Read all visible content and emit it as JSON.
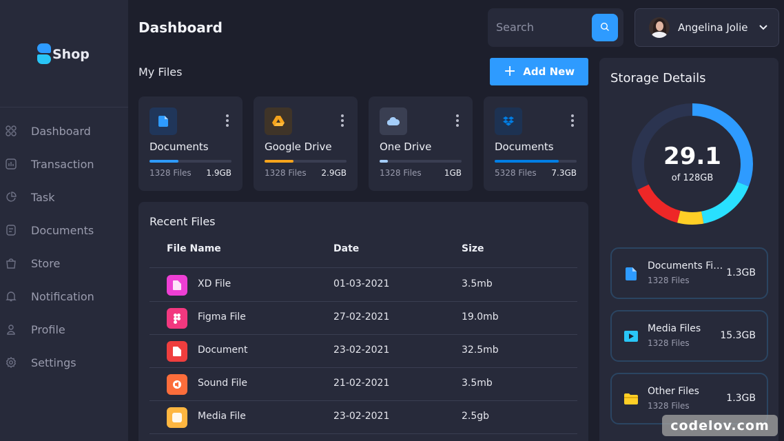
{
  "brand": {
    "name": "Shop",
    "colors": {
      "accent": "#2e9bff",
      "cyan": "#29c5f6"
    }
  },
  "sidebar": {
    "items": [
      {
        "label": "Dashboard",
        "icon": "grid-icon"
      },
      {
        "label": "Transaction",
        "icon": "chart-icon"
      },
      {
        "label": "Task",
        "icon": "pie-icon"
      },
      {
        "label": "Documents",
        "icon": "document-icon"
      },
      {
        "label": "Store",
        "icon": "bag-icon"
      },
      {
        "label": "Notification",
        "icon": "bell-icon"
      },
      {
        "label": "Profile",
        "icon": "user-icon"
      },
      {
        "label": "Settings",
        "icon": "gear-icon"
      }
    ]
  },
  "header": {
    "title": "Dashboard",
    "search_placeholder": "Search",
    "user_name": "Angelina Jolie"
  },
  "my_files": {
    "title": "My Files",
    "add_label": "Add New",
    "cards": [
      {
        "name": "Documents",
        "count": "1328 Files",
        "size": "1.9GB",
        "progress": 0.35,
        "color": "#2e9bff",
        "icon": "document-icon"
      },
      {
        "name": "Google Drive",
        "count": "1328 Files",
        "size": "2.9GB",
        "progress": 0.35,
        "color": "#f6a41c",
        "icon": "google-drive-icon"
      },
      {
        "name": "One Drive",
        "count": "1328 Files",
        "size": "1GB",
        "progress": 0.1,
        "color": "#a4cdf9",
        "icon": "cloud-icon"
      },
      {
        "name": "Documents",
        "count": "5328 Files",
        "size": "7.3GB",
        "progress": 0.78,
        "color": "#007ee5",
        "icon": "dropbox-icon"
      }
    ]
  },
  "recent": {
    "title": "Recent Files",
    "columns": [
      "File Name",
      "Date",
      "Size"
    ],
    "rows": [
      {
        "name": "XD File",
        "date": "01-03-2021",
        "size": "3.5mb",
        "color": "#ee3fd4",
        "icon": "xd-file-icon"
      },
      {
        "name": "Figma File",
        "date": "27-02-2021",
        "size": "19.0mb",
        "color": "#f2387f",
        "icon": "figma-icon"
      },
      {
        "name": "Document",
        "date": "23-02-2021",
        "size": "32.5mb",
        "color": "#ef3e3e",
        "icon": "document-icon"
      },
      {
        "name": "Sound File",
        "date": "21-02-2021",
        "size": "3.5mb",
        "color": "#fc6d3b",
        "icon": "sound-icon"
      },
      {
        "name": "Media File",
        "date": "23-02-2021",
        "size": "2.5gb",
        "color": "#feb640",
        "icon": "media-icon"
      }
    ]
  },
  "storage": {
    "title": "Storage Details",
    "used": "29.1",
    "total_label": "of 128GB",
    "segments": [
      {
        "color": "#2e9bff",
        "fraction": 0.31
      },
      {
        "color": "#29e0ff",
        "fraction": 0.16
      },
      {
        "color": "#ffcf26",
        "fraction": 0.07
      },
      {
        "color": "#ee2727",
        "fraction": 0.14
      },
      {
        "color": "#2b3450",
        "fraction": 0.32
      }
    ],
    "items": [
      {
        "name": "Documents Files",
        "count": "1328 Files",
        "size": "1.3GB",
        "color": "#2e9bff",
        "icon": "document-icon"
      },
      {
        "name": "Media Files",
        "count": "1328 Files",
        "size": "15.3GB",
        "color": "#29c5f6",
        "icon": "media-icon"
      },
      {
        "name": "Other Files",
        "count": "1328 Files",
        "size": "1.3GB",
        "color": "#ffcf26",
        "icon": "folder-icon"
      }
    ]
  },
  "watermark": "codelov.com"
}
